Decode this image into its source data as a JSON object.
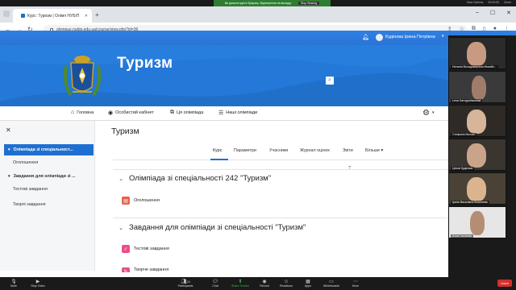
{
  "zoom": {
    "share_notice": "Ви демонструєте браузер. Відтворення на вкладці.",
    "share_stop": "Stop Sharing",
    "view_options": "View Options",
    "top_right": [
      "00:09:53",
      "Zoom"
    ],
    "toolbar": [
      {
        "label": "Mute",
        "icon": "mic-icon"
      },
      {
        "label": "Stop Video",
        "icon": "video-icon"
      },
      {
        "label": "Participants",
        "icon": "participants-icon",
        "count": "24"
      },
      {
        "label": "Chat",
        "icon": "chat-icon"
      },
      {
        "label": "Share Screen",
        "icon": "share-screen-icon"
      },
      {
        "label": "Record",
        "icon": "record-icon"
      },
      {
        "label": "Reactions",
        "icon": "reactions-icon"
      },
      {
        "label": "Apps",
        "icon": "apps-icon"
      },
      {
        "label": "Whiteboards",
        "icon": "whiteboard-icon"
      },
      {
        "label": "More",
        "icon": "more-icon"
      }
    ],
    "leave_label": "Leave",
    "participants": [
      {
        "name": "Наталія Володимирівна Михайл..."
      },
      {
        "name": "Lena Хатчура/Іванова"
      },
      {
        "name": "Стефанія Мосько"
      },
      {
        "name": "Цехов Кудінова"
      },
      {
        "name": "Ірина Василівна Кошелева"
      },
      {
        "name": "Алла Ганченко"
      }
    ]
  },
  "browser": {
    "tab_title": "Курс: Туризм | Олімп НУБіП",
    "url": "olympus.nubip.edu.ua/course/view.php?id=36"
  },
  "site": {
    "user_name": "Кудінова Ірина Петрівна",
    "title": "Туризм",
    "menu": [
      {
        "label": "Головна",
        "icon": "home-icon"
      },
      {
        "label": "Особистий кабінет",
        "icon": "dashboard-icon"
      },
      {
        "label": "Ця олімпіада",
        "icon": "sitemap-icon"
      },
      {
        "label": "Наші олімпіади",
        "icon": "list-icon"
      }
    ]
  },
  "drawer": {
    "items": [
      {
        "label": "Олімпіада зі спеціальності 242 \"Туризм\"",
        "display": "Олімпіада зі спеціальност...",
        "active": true
      },
      {
        "label": "Оголошення"
      },
      {
        "label": "Завдання для олімпіади зі ...",
        "display": "Завдання для олімпіади зі ..."
      },
      {
        "label": "Тестові завдання"
      },
      {
        "label": "Творчі завдання"
      }
    ]
  },
  "course": {
    "page_title": "Туризм",
    "tabs": [
      "Курс",
      "Параметри",
      "Учасники",
      "Журнал оцінок",
      "Звіти",
      "Більше"
    ],
    "sections": [
      {
        "title": "Олімпіада зі спеціальності 242 \"Туризм\"",
        "activities": [
          {
            "label": "Оголошення",
            "icon": "forum-icon",
            "color": "#e8614e"
          }
        ]
      },
      {
        "title": "Завдання для олімпіади зі спеціальності \"Туризм\"",
        "activities": [
          {
            "label": "Тестові завдання",
            "icon": "quiz-icon",
            "color": "#e84e8a"
          },
          {
            "label": "Творче завдання",
            "icon": "assignment-icon",
            "color": "#e84e8a"
          }
        ]
      }
    ]
  },
  "colors": {
    "brand_blue": "#2378d8",
    "active_blue": "#1f6fd1",
    "leave_red": "#d32f2f"
  }
}
